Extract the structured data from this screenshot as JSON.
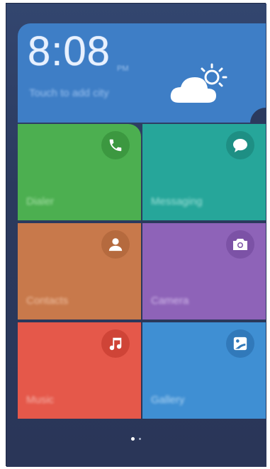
{
  "weather": {
    "time": "8:08",
    "period": "PM",
    "city_hint": "Touch to add city",
    "icon": "partly-sunny-icon"
  },
  "tiles": [
    {
      "label": "Dialer",
      "icon": "phone-icon",
      "color": "#4caf50"
    },
    {
      "label": "Messaging",
      "icon": "chat-bubble-icon",
      "color": "#26a69a"
    },
    {
      "label": "Contacts",
      "icon": "person-icon",
      "color": "#c8794b"
    },
    {
      "label": "Camera",
      "icon": "camera-icon",
      "color": "#8e63b8"
    },
    {
      "label": "Music",
      "icon": "music-note-icon",
      "color": "#e5584a"
    },
    {
      "label": "Gallery",
      "icon": "gallery-icon",
      "color": "#3f8fd3"
    }
  ],
  "pager": {
    "pages": 2,
    "current": 1
  },
  "colors": {
    "background": "#2b3a5e",
    "weather_card": "#3e7ec6"
  }
}
